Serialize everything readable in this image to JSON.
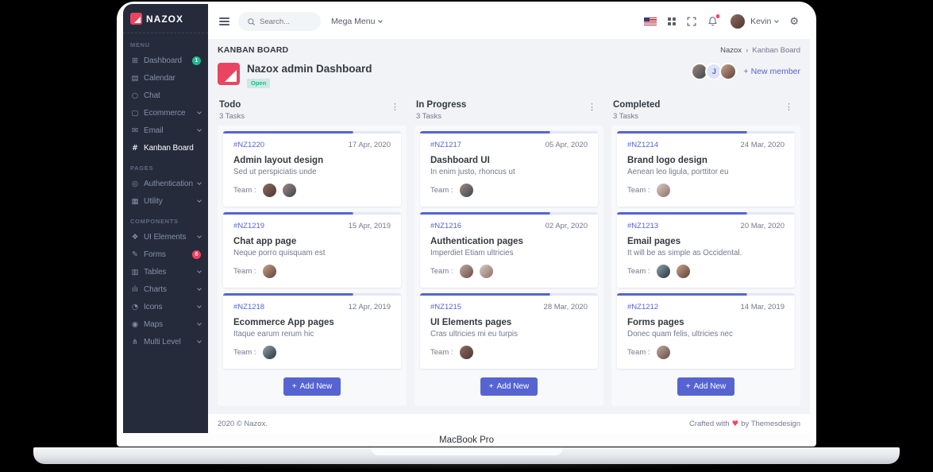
{
  "device": {
    "label": "MacBook Pro"
  },
  "brand": {
    "name": "NAZOX"
  },
  "colors": {
    "primary": "#5664d2",
    "success": "#1cbb8c",
    "danger": "#ff3d60",
    "sidebar_bg": "#252b3b",
    "content_bg": "#f1f3f7",
    "brand_red": "#e94560"
  },
  "icons": {
    "dashboard": "⊞",
    "calendar": "▤",
    "chat": "○",
    "ecommerce": "▢",
    "email": "✉",
    "kanban": "#",
    "authentication": "◎",
    "utility": "▦",
    "ui_elements": "❖",
    "forms": "✎",
    "tables": "▥",
    "charts": "ılı",
    "icons": "◔",
    "maps": "◉",
    "multi_level": "⋔",
    "dots_vertical": "⋮",
    "gear": "⚙",
    "heart": "♥",
    "plus": "+",
    "breadcrumb_sep": "›"
  },
  "topbar": {
    "search_placeholder": "Search...",
    "mega_menu": "Mega Menu",
    "user": {
      "name": "Kevin"
    }
  },
  "sidebar": {
    "sections": [
      {
        "title": "MENU",
        "items": [
          {
            "label": "Dashboard",
            "badge": "1"
          },
          {
            "label": "Calendar"
          },
          {
            "label": "Chat"
          },
          {
            "label": "Ecommerce"
          },
          {
            "label": "Email"
          },
          {
            "label": "Kanban Board"
          }
        ]
      },
      {
        "title": "PAGES",
        "items": [
          {
            "label": "Authentication"
          },
          {
            "label": "Utility"
          }
        ]
      },
      {
        "title": "COMPONENTS",
        "items": [
          {
            "label": "UI Elements"
          },
          {
            "label": "Forms",
            "badge": "6"
          },
          {
            "label": "Tables"
          },
          {
            "label": "Charts"
          },
          {
            "label": "Icons"
          },
          {
            "label": "Maps"
          },
          {
            "label": "Multi Level"
          }
        ]
      }
    ]
  },
  "page": {
    "title": "KANBAN BOARD",
    "breadcrumb": {
      "parent": "Nazox",
      "current": "Kanban Board"
    },
    "board": {
      "title": "Nazox admin Dashboard",
      "status": "Open",
      "team_initial": "J",
      "add_member": "New member"
    }
  },
  "labels": {
    "team": "Team :"
  },
  "board": {
    "columns": [
      {
        "name": "Todo",
        "tasks": "3 Tasks",
        "add_button": "Add New",
        "cards": [
          {
            "id": "#NZ1220",
            "date": "17 Apr, 2020",
            "title": "Admin layout design",
            "desc": "Sed ut perspiciatis unde"
          },
          {
            "id": "#NZ1219",
            "date": "15 Apr, 2019",
            "title": "Chat app page",
            "desc": "Neque porro quisquam est"
          },
          {
            "id": "#NZ1218",
            "date": "12 Apr, 2019",
            "title": "Ecommerce App pages",
            "desc": "Itaque earum rerum hic"
          }
        ]
      },
      {
        "name": "In Progress",
        "tasks": "3 Tasks",
        "add_button": "Add New",
        "cards": [
          {
            "id": "#NZ1217",
            "date": "05 Apr, 2020",
            "title": "Dashboard UI",
            "desc": "In enim justo, rhoncus ut"
          },
          {
            "id": "#NZ1216",
            "date": "02 Apr, 2020",
            "title": "Authentication pages",
            "desc": "Imperdiet Etiam ultricies"
          },
          {
            "id": "#NZ1215",
            "date": "28 Mar, 2020",
            "title": "UI Elements pages",
            "desc": "Cras ultricies mi eu turpis"
          }
        ]
      },
      {
        "name": "Completed",
        "tasks": "3 Tasks",
        "add_button": "Add New",
        "cards": [
          {
            "id": "#NZ1214",
            "date": "24 Mar, 2020",
            "title": "Brand logo design",
            "desc": "Aenean leo ligula, porttitor eu"
          },
          {
            "id": "#NZ1213",
            "date": "20 Mar, 2020",
            "title": "Email pages",
            "desc": "It will be as simple as Occidental."
          },
          {
            "id": "#NZ1212",
            "date": "14 Mar, 2019",
            "title": "Forms pages",
            "desc": "Donec quam felis, ultricies nec"
          }
        ]
      }
    ]
  },
  "footer": {
    "copyright": "2020 © Nazox.",
    "credit_prefix": "Crafted with",
    "credit_suffix": "by Themesdesign"
  }
}
